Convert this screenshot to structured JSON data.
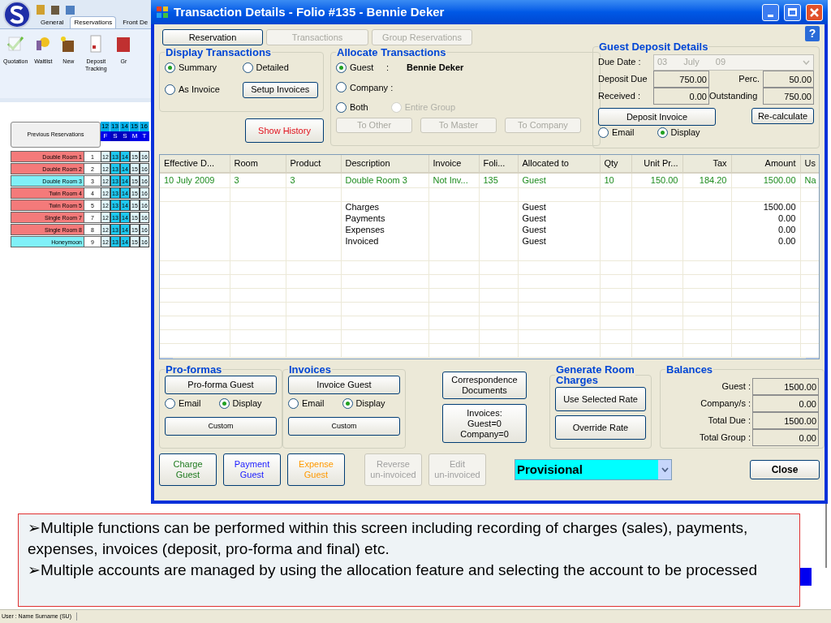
{
  "app": {
    "tabs": [
      {
        "label": "General",
        "selected": false
      },
      {
        "label": "Reservations",
        "selected": true
      },
      {
        "label": "Front De",
        "selected": false
      }
    ],
    "ribbon_buttons": [
      {
        "label": "Quotation",
        "kind": "quotation"
      },
      {
        "label": "Waitlist",
        "kind": "waitlist"
      },
      {
        "label": "New",
        "kind": "new"
      },
      {
        "label": "Deposit Tracking",
        "kind": "deposit"
      },
      {
        "label": "Gr",
        "kind": "group"
      }
    ],
    "previous_reservations_button": "Previous Reservations",
    "calendar": {
      "dates": [
        "12",
        "13",
        "14",
        "15",
        "16"
      ],
      "days": [
        {
          "label": "F",
          "weekend": false
        },
        {
          "label": "S",
          "weekend": true
        },
        {
          "label": "S",
          "weekend": true
        },
        {
          "label": "M",
          "weekend": false
        },
        {
          "label": "T",
          "weekend": false
        }
      ]
    },
    "rooms": [
      {
        "name": "Double Room 1",
        "number": "1",
        "color": "#f47a7a",
        "cells": [
          "12",
          "13",
          "14",
          "15",
          "16"
        ]
      },
      {
        "name": "Double Room 2",
        "number": "2",
        "color": "#f47a7a",
        "cells": [
          "12",
          "13",
          "14",
          "15",
          "16"
        ]
      },
      {
        "name": "Double Room 3",
        "number": "3",
        "color": "#80f0f8",
        "cells": [
          "12",
          "13",
          "14",
          "15",
          "16"
        ]
      },
      {
        "name": "Twin Room 4",
        "number": "4",
        "color": "#f47a7a",
        "cells": [
          "12",
          "13",
          "14",
          "15",
          "16"
        ]
      },
      {
        "name": "Twin Room 5",
        "number": "5",
        "color": "#f47a7a",
        "cells": [
          "12",
          "13",
          "14",
          "15",
          "16"
        ]
      },
      {
        "name": "Single Room 7",
        "number": "7",
        "color": "#f47a7a",
        "cells": [
          "12",
          "13",
          "14",
          "15",
          "16"
        ]
      },
      {
        "name": "Single  Room 8",
        "number": "8",
        "color": "#f47a7a",
        "cells": [
          "12",
          "13",
          "14",
          "15",
          "16"
        ]
      },
      {
        "name": "Honeymoon",
        "number": "9",
        "color": "#80f0f8",
        "cells": [
          "12",
          "13",
          "14",
          "15",
          "16"
        ]
      }
    ],
    "status_bar": "User : Name Surname (SU)"
  },
  "window": {
    "title": "Transaction Details - Folio #135 - Bennie Deker",
    "nav_buttons": [
      {
        "label": "Reservation",
        "disabled": false
      },
      {
        "label": "Transactions",
        "disabled": true
      },
      {
        "label": "Group Reservations",
        "disabled": true
      }
    ],
    "display_transactions": {
      "title": "Display Transactions",
      "options": [
        {
          "label": "Summary",
          "selected": true
        },
        {
          "label": "Detailed",
          "selected": false
        },
        {
          "label": "As Invoice",
          "selected": false
        }
      ],
      "setup_button": "Setup Invoices"
    },
    "show_history_button": "Show History",
    "allocate": {
      "title": "Allocate Transactions",
      "options": [
        {
          "label": "Guest",
          "selected": true,
          "disabled": false
        },
        {
          "label": "Company :",
          "selected": false,
          "disabled": false
        },
        {
          "label": "Both",
          "selected": false,
          "disabled": false
        },
        {
          "label": "Entire Group",
          "selected": false,
          "disabled": true
        }
      ],
      "guest_separator": ":",
      "guest_name": "Bennie Deker",
      "buttons": [
        {
          "label": "To Other",
          "disabled": true
        },
        {
          "label": "To Master",
          "disabled": true
        },
        {
          "label": "To Company",
          "disabled": true
        }
      ]
    },
    "deposit": {
      "title": "Guest Deposit Details",
      "due_date_label": "Due Date :",
      "due_date": [
        "03",
        "July",
        "09"
      ],
      "deposit_due_label": "Deposit Due",
      "deposit_due": "750.00",
      "perc_label": "Perc.",
      "perc": "50.00",
      "received_label": "Received :",
      "received": "0.00",
      "outstanding_label": "Outstanding",
      "outstanding": "750.00",
      "invoice_button": "Deposit Invoice",
      "recalculate_button": "Re-calculate",
      "delivery": [
        {
          "label": "Email",
          "selected": false
        },
        {
          "label": "Display",
          "selected": true
        }
      ]
    },
    "table": {
      "columns": [
        "Effective D...",
        "Room",
        "Product",
        "Description",
        "Invoice",
        "Foli...",
        "Allocated to",
        "Qty",
        "Unit Pr...",
        "Tax",
        "Amount",
        "Us"
      ],
      "rows": [
        {
          "kind": "transaction",
          "cells": [
            "10 July 2009",
            "3",
            "3",
            "Double Room 3",
            "Not Inv...",
            "135",
            "Guest",
            "10",
            "150.00",
            "184.20",
            "1500.00",
            "Na"
          ]
        },
        {
          "kind": "blank"
        },
        {
          "kind": "summary",
          "cells": {
            "3": "Charges",
            "6": "Guest",
            "10": "1500.00"
          }
        },
        {
          "kind": "summary",
          "cells": {
            "3": "Payments",
            "6": "Guest",
            "10": "0.00"
          }
        },
        {
          "kind": "summary",
          "cells": {
            "3": "Expenses",
            "6": "Guest",
            "10": "0.00"
          }
        },
        {
          "kind": "summary",
          "cells": {
            "3": "Invoiced",
            "6": "Guest",
            "10": "0.00"
          }
        }
      ]
    },
    "proformas": {
      "title": "Pro-formas",
      "button": "Pro-forma Guest",
      "delivery": [
        {
          "label": "Email",
          "selected": false
        },
        {
          "label": "Display",
          "selected": true
        }
      ],
      "custom_button": "Custom"
    },
    "invoices": {
      "title": "Invoices",
      "button": "Invoice Guest",
      "delivery": [
        {
          "label": "Email",
          "selected": false
        },
        {
          "label": "Display",
          "selected": true
        }
      ],
      "custom_button": "Custom"
    },
    "correspondence_button": "Correspondence\nDocuments",
    "invoice_count_button": "Invoices:\nGuest=0\nCompany=0",
    "generate": {
      "title": "Generate  Room\nCharges",
      "buttons": [
        "Use Selected Rate",
        "Override Rate"
      ]
    },
    "balances": {
      "title": "Balances",
      "rows": [
        {
          "label": "Guest :",
          "value": "1500.00"
        },
        {
          "label": "Company/s :",
          "value": "0.00"
        },
        {
          "label": "Total Due :",
          "value": "1500.00"
        },
        {
          "label": "Total Group :",
          "value": "0.00"
        }
      ]
    },
    "action_buttons": [
      {
        "label": "Charge\nGuest",
        "color": "#1e7a1e",
        "disabled": false
      },
      {
        "label": "Payment\nGuest",
        "color": "#1a1aff",
        "disabled": false
      },
      {
        "label": "Expense\nGuest",
        "color": "#ff9900",
        "disabled": false
      },
      {
        "label": "Reverse\nun-invoiced",
        "color": "#a0a0a0",
        "disabled": true
      },
      {
        "label": "Edit\nun-invoiced",
        "color": "#a0a0a0",
        "disabled": true
      }
    ],
    "status_select": "Provisional",
    "close_button": "Close",
    "help_button": "?"
  },
  "callout": {
    "bullets": [
      "➢Multiple functions can be performed within this screen including recording of charges (sales), payments, expenses, invoices (deposit, pro-forma and final) etc.",
      "➢Multiple accounts are managed by using the allocation feature and selecting the account to be processed"
    ]
  }
}
